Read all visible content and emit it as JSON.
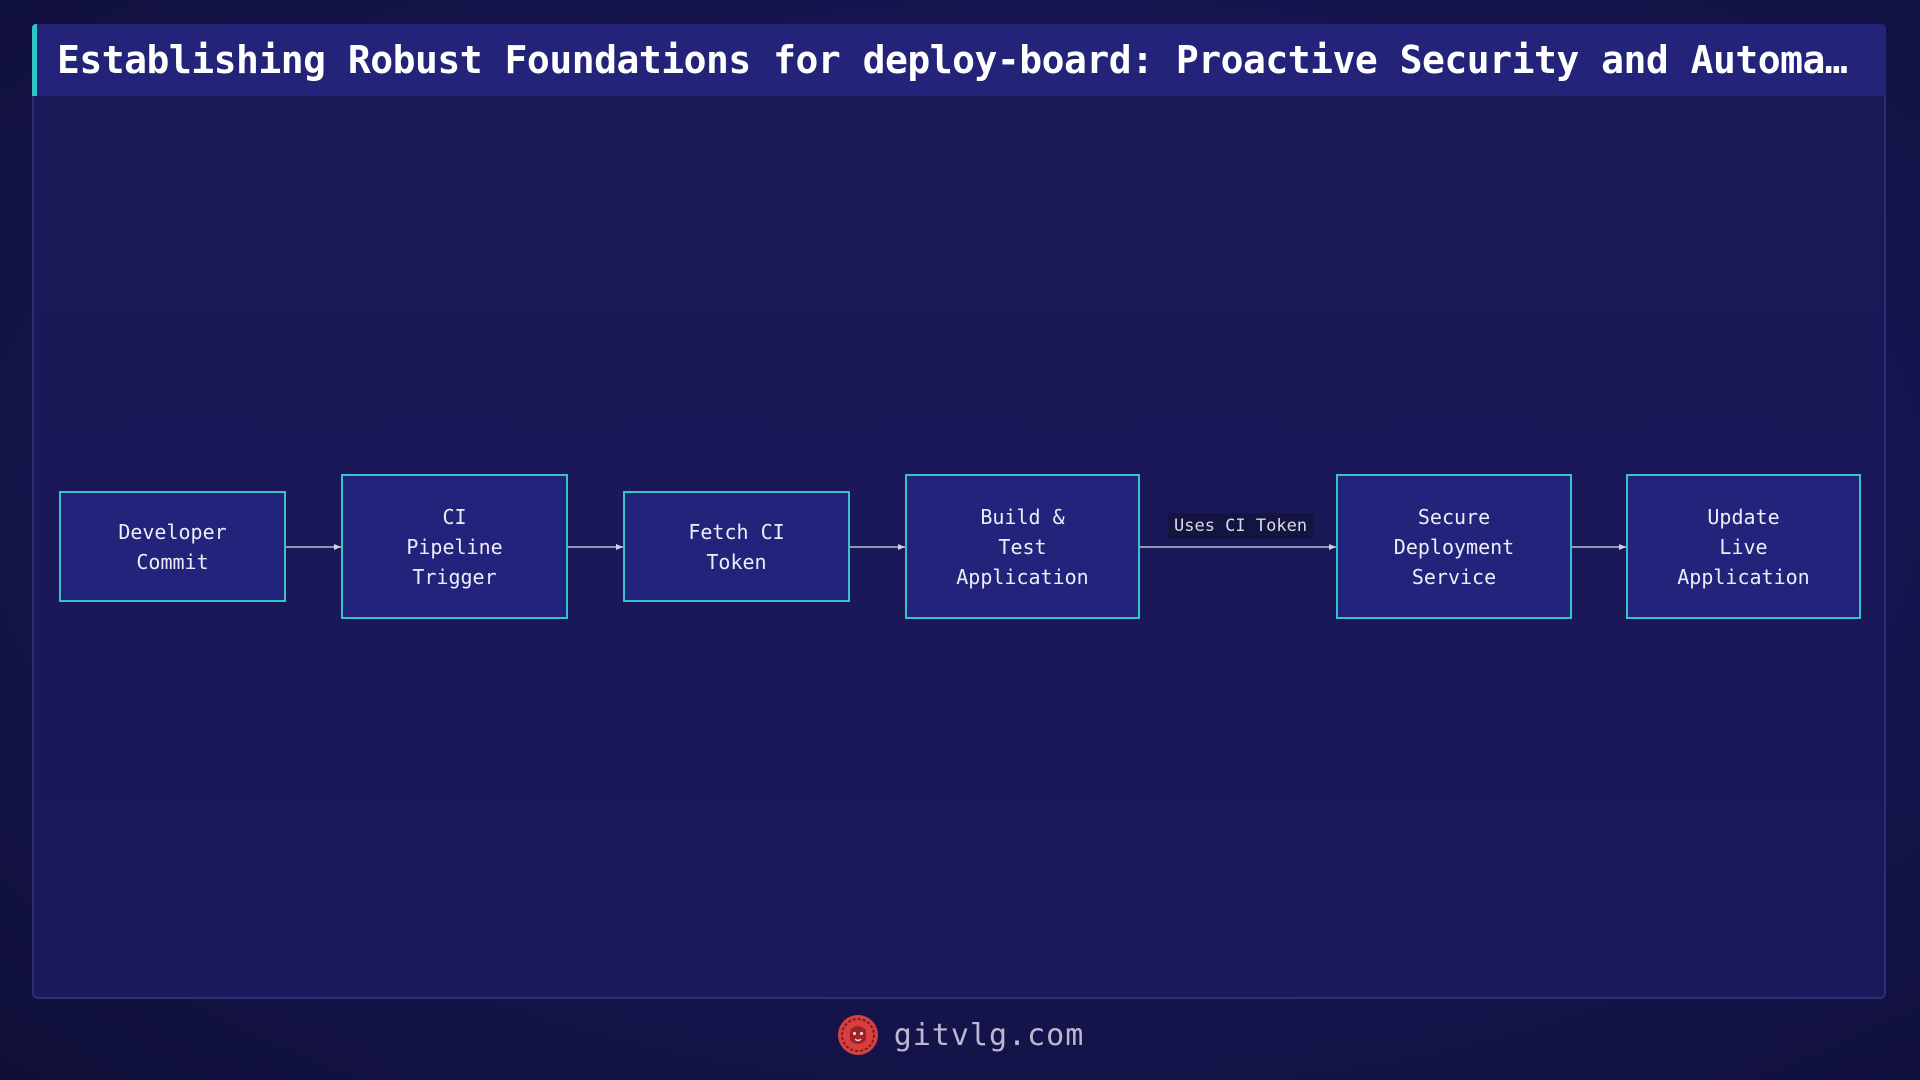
{
  "header": {
    "title": "Establishing Robust Foundations for deploy-board: Proactive Security and Automa…"
  },
  "diagram": {
    "nodes": [
      {
        "id": "developer-commit",
        "label": "Developer\nCommit"
      },
      {
        "id": "ci-pipeline-trigger",
        "label": "CI\nPipeline\nTrigger"
      },
      {
        "id": "fetch-ci-token",
        "label": "Fetch CI\nToken"
      },
      {
        "id": "build-test-application",
        "label": "Build &\nTest\nApplication"
      },
      {
        "id": "secure-deployment-service",
        "label": "Secure\nDeployment\nService"
      },
      {
        "id": "update-live-application",
        "label": "Update\nLive\nApplication"
      }
    ],
    "edges": [
      {
        "from": "developer-commit",
        "to": "ci-pipeline-trigger",
        "label": ""
      },
      {
        "from": "ci-pipeline-trigger",
        "to": "fetch-ci-token",
        "label": ""
      },
      {
        "from": "fetch-ci-token",
        "to": "build-test-application",
        "label": ""
      },
      {
        "from": "build-test-application",
        "to": "secure-deployment-service",
        "label": "Uses CI Token"
      },
      {
        "from": "secure-deployment-service",
        "to": "update-live-application",
        "label": ""
      }
    ]
  },
  "footer": {
    "logo_icon": "lion-head-icon",
    "site": "gitvlg.com"
  },
  "colors": {
    "background": "#161550",
    "node_fill": "#22237a",
    "node_border": "#36c3c9",
    "title_accent": "#2fc6c6",
    "logo": "#d8403f"
  }
}
